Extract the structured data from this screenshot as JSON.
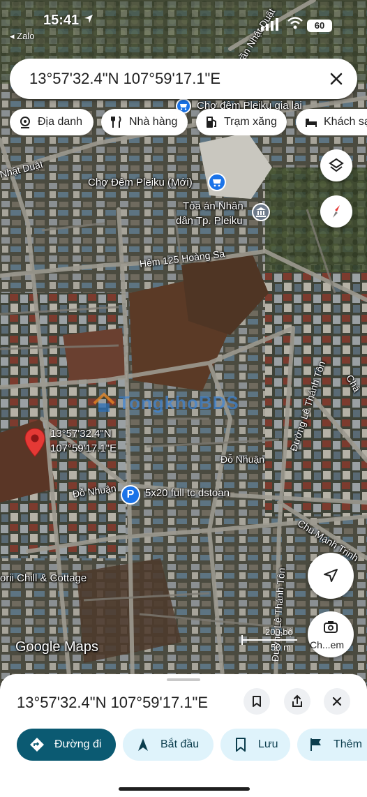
{
  "status_bar": {
    "time": "15:41",
    "back_app": "◂ Zalo",
    "battery": "60"
  },
  "search": {
    "query": "13°57'32.4\"N 107°59'17.1\"E"
  },
  "chips": [
    {
      "label": "Địa danh",
      "icon": "landmark-icon"
    },
    {
      "label": "Nhà hàng",
      "icon": "fork-knife-icon"
    },
    {
      "label": "Trạm xăng",
      "icon": "gas-pump-icon"
    },
    {
      "label": "Khách sạn",
      "icon": "bed-icon"
    }
  ],
  "map": {
    "pois": {
      "market_top": "Chợ đêm Pleiku gia lai",
      "market_new": "Chợ Đêm Pleiku (Mới)",
      "court_line1": "Tòa án Nhân",
      "court_line2": "dân Tp. Pleiku",
      "parking": "5x20 full tc dstoan",
      "cottage": "orii Chill & Cottage"
    },
    "streets": {
      "tran_nhat_duat_top": "Trần Nhật Duật",
      "nhat_duat_left": "Nhật Duật",
      "hem_125": "Hẻm 125 Hoàng Sa",
      "le_thanh_ton_upper": "Đường Lê Thánh Tôn",
      "le_thanh_ton_lower": "Đường Lê Thánh Tôn",
      "do_nhuan_right": "Đỗ Nhuận",
      "do_nhuan_left": "Đỗ Nhuận",
      "chu_manh_trinh": "Chu Mạnh Trinh",
      "cha_edge": "Châ"
    },
    "pin": {
      "line1": "13°57'32.4\"N",
      "line2": "107°59'17.1\"E"
    },
    "watermark": "TongkhoBDS",
    "logo": "Google Maps",
    "scale": {
      "feet": "200 bộ",
      "meters": "50 m"
    },
    "capture_label": "Ch...em"
  },
  "sheet": {
    "coords": "13°57'32.4\"N 107°59'17.1\"E",
    "actions": [
      {
        "label": "Đường đi",
        "primary": true
      },
      {
        "label": "Bắt đầu",
        "primary": false
      },
      {
        "label": "Lưu",
        "primary": false
      },
      {
        "label": "Thêm",
        "primary": false
      }
    ]
  },
  "colors": {
    "accent": "#0b5a72",
    "chip_bg": "#dff3fb",
    "pin_red": "#e53935",
    "parking_blue": "#1a73e8"
  }
}
